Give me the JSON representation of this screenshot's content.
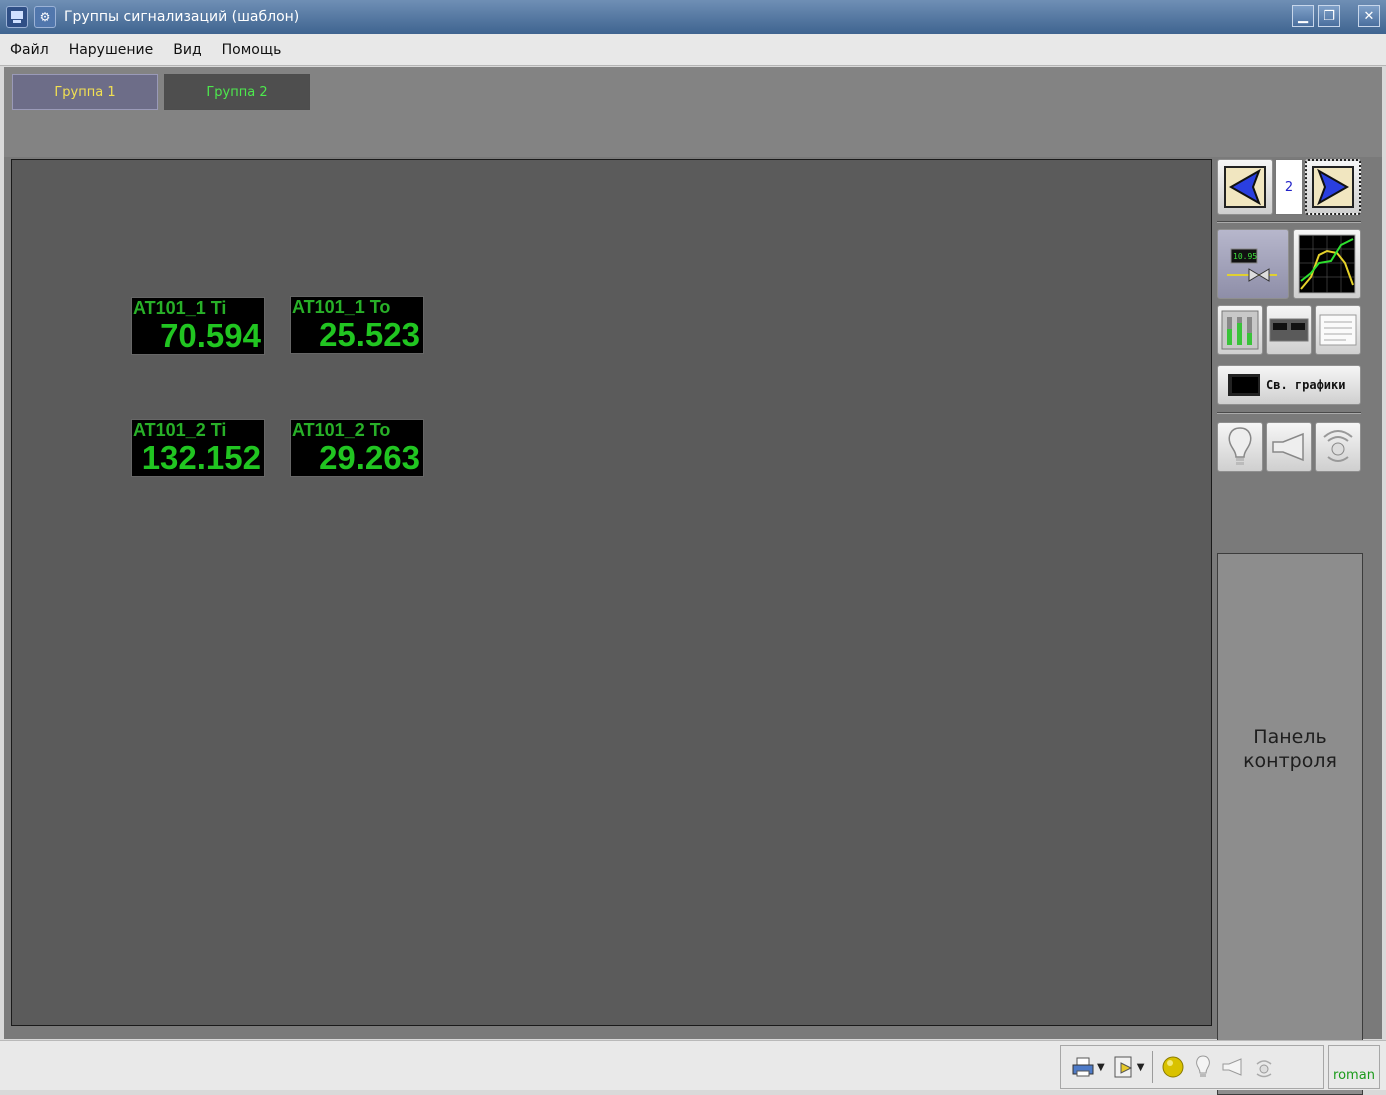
{
  "window": {
    "title": "Группы сигнализаций (шаблон)",
    "buttons": {
      "minimize": "▁",
      "maximize": "❐",
      "close": "✕"
    }
  },
  "menu": {
    "items": [
      "Файл",
      "Нарушение",
      "Вид",
      "Помощь"
    ]
  },
  "groups": {
    "tabs": [
      "Группа 1",
      "Группа 2"
    ],
    "active_index": 0
  },
  "indicators": [
    {
      "label": "AT101_1 Ti",
      "value": "70.594"
    },
    {
      "label": "AT101_1 To",
      "value": "25.523"
    },
    {
      "label": "AT101_2 Ti",
      "value": "132.152"
    },
    {
      "label": "AT101_2 To",
      "value": "29.263"
    }
  ],
  "right_panel": {
    "page_number": "2",
    "mini_display_value": "10.95",
    "trends_button_label": "Св. графики",
    "control_panel_label": "Панель контроля"
  },
  "statusbar": {
    "user": "roman"
  },
  "colors": {
    "indicator_text": "#21c521",
    "tab_active_text": "#f2e052",
    "tab_inactive_text": "#4de84d",
    "page_number": "#2323c8"
  }
}
